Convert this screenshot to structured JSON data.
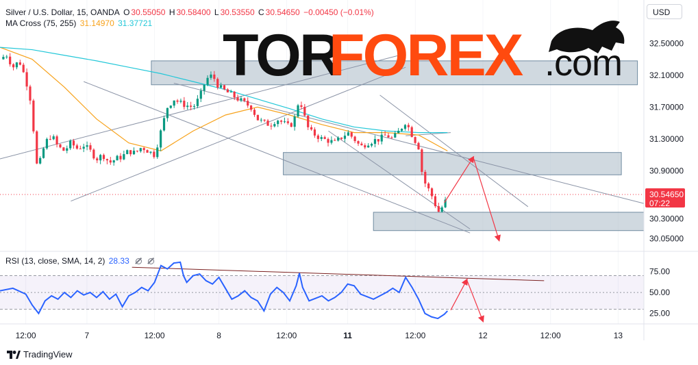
{
  "header": {
    "symbol": "Silver / U.S. Dollar, 15, OANDA",
    "open_label": "O",
    "open": "30.55050",
    "high_label": "H",
    "high": "30.58400",
    "low_label": "L",
    "low": "30.53550",
    "close_label": "C",
    "close": "30.54650",
    "change": "−0.00450 (−0.01%)",
    "ma_title": "MA Cross (75, 255)",
    "ma_fast": "31.14970",
    "ma_slow": "31.37721",
    "rsi_title": "RSI (13, close, SMA, 14, 2)",
    "rsi_value": "28.33"
  },
  "currency_button": "USD",
  "price_tag": {
    "price": "30.54650",
    "countdown": "07:22"
  },
  "brand": {
    "tor": "TOR",
    "forex": "FOREX",
    "com": ".com"
  },
  "footer": {
    "tradingview": "TradingView"
  },
  "colors": {
    "up": "#089981",
    "down": "#f23645",
    "ma_fast": "#f7a21b",
    "ma_slow": "#22c7d8",
    "rsi": "#2962ff",
    "zone": "#a9b9c6",
    "arrow": "#f23645",
    "trendline": "#8a93a6",
    "rsi_trend": "#7a1f1f"
  },
  "chart_data": [
    {
      "type": "candlestick",
      "title": "Silver / U.S. Dollar, 15, OANDA",
      "price_axis_ticks": [
        "32.50000",
        "32.10000",
        "31.70000",
        "31.30000",
        "30.90000",
        "30.30000",
        "30.05000"
      ],
      "ylim": [
        29.95,
        32.7
      ],
      "x_ticks": [
        "12:00",
        "7",
        "12:00",
        "8",
        "12:00",
        "11",
        "12:00",
        "12",
        "12:00",
        "13"
      ],
      "x_tick_bold": [
        false,
        false,
        false,
        false,
        false,
        true,
        false,
        false,
        false,
        false
      ],
      "x_tick_pos": [
        0.04,
        0.135,
        0.24,
        0.34,
        0.445,
        0.54,
        0.645,
        0.75,
        0.855,
        0.96
      ],
      "price_path": [
        [
          0.0,
          32.3
        ],
        [
          0.01,
          32.36
        ],
        [
          0.02,
          32.2
        ],
        [
          0.03,
          32.28
        ],
        [
          0.04,
          32.05
        ],
        [
          0.05,
          31.7
        ],
        [
          0.055,
          31.0
        ],
        [
          0.06,
          30.95
        ],
        [
          0.07,
          31.25
        ],
        [
          0.08,
          31.35
        ],
        [
          0.09,
          31.2
        ],
        [
          0.1,
          31.15
        ],
        [
          0.11,
          31.25
        ],
        [
          0.12,
          31.18
        ],
        [
          0.13,
          31.22
        ],
        [
          0.14,
          31.15
        ],
        [
          0.15,
          31.05
        ],
        [
          0.16,
          31.1
        ],
        [
          0.17,
          31.0
        ],
        [
          0.18,
          31.05
        ],
        [
          0.19,
          31.08
        ],
        [
          0.2,
          31.15
        ],
        [
          0.21,
          31.12
        ],
        [
          0.22,
          31.2
        ],
        [
          0.23,
          31.15
        ],
        [
          0.24,
          31.1
        ],
        [
          0.25,
          31.4
        ],
        [
          0.26,
          31.7
        ],
        [
          0.27,
          31.8
        ],
        [
          0.28,
          31.75
        ],
        [
          0.29,
          31.72
        ],
        [
          0.3,
          31.7
        ],
        [
          0.31,
          31.82
        ],
        [
          0.32,
          32.05
        ],
        [
          0.33,
          32.1
        ],
        [
          0.34,
          31.95
        ],
        [
          0.35,
          31.9
        ],
        [
          0.36,
          31.85
        ],
        [
          0.37,
          31.8
        ],
        [
          0.38,
          31.75
        ],
        [
          0.39,
          31.7
        ],
        [
          0.4,
          31.55
        ],
        [
          0.41,
          31.5
        ],
        [
          0.42,
          31.48
        ],
        [
          0.43,
          31.55
        ],
        [
          0.44,
          31.5
        ],
        [
          0.45,
          31.45
        ],
        [
          0.46,
          31.6
        ],
        [
          0.465,
          31.85
        ],
        [
          0.47,
          31.65
        ],
        [
          0.48,
          31.4
        ],
        [
          0.49,
          31.35
        ],
        [
          0.5,
          31.3
        ],
        [
          0.51,
          31.28
        ],
        [
          0.52,
          31.25
        ],
        [
          0.53,
          31.32
        ],
        [
          0.54,
          31.38
        ],
        [
          0.55,
          31.3
        ],
        [
          0.56,
          31.2
        ],
        [
          0.57,
          31.25
        ],
        [
          0.58,
          31.28
        ],
        [
          0.59,
          31.3
        ],
        [
          0.6,
          31.35
        ],
        [
          0.61,
          31.3
        ],
        [
          0.62,
          31.4
        ],
        [
          0.63,
          31.52
        ],
        [
          0.64,
          31.35
        ],
        [
          0.65,
          31.2
        ],
        [
          0.655,
          30.9
        ],
        [
          0.66,
          30.75
        ],
        [
          0.67,
          30.6
        ],
        [
          0.675,
          30.5
        ],
        [
          0.68,
          30.38
        ],
        [
          0.685,
          30.42
        ],
        [
          0.69,
          30.5
        ],
        [
          0.695,
          30.55
        ]
      ],
      "series": [
        {
          "name": "MA Cross (75, 255)",
          "points": [
            [
              0.0,
              32.45
            ],
            [
              0.05,
              32.3
            ],
            [
              0.1,
              31.95
            ],
            [
              0.15,
              31.55
            ],
            [
              0.2,
              31.25
            ],
            [
              0.25,
              31.15
            ],
            [
              0.3,
              31.4
            ],
            [
              0.35,
              31.6
            ],
            [
              0.4,
              31.7
            ],
            [
              0.45,
              31.6
            ],
            [
              0.5,
              31.48
            ],
            [
              0.55,
              31.38
            ],
            [
              0.6,
              31.38
            ],
            [
              0.65,
              31.35
            ],
            [
              0.695,
              31.15
            ]
          ]
        },
        {
          "name": "MA Cross (75, 255)",
          "points": [
            [
              0.0,
              32.45
            ],
            [
              0.05,
              32.42
            ],
            [
              0.1,
              32.35
            ],
            [
              0.15,
              32.28
            ],
            [
              0.2,
              32.2
            ],
            [
              0.25,
              32.12
            ],
            [
              0.3,
              32.02
            ],
            [
              0.35,
              31.92
            ],
            [
              0.4,
              31.8
            ],
            [
              0.45,
              31.68
            ],
            [
              0.5,
              31.55
            ],
            [
              0.55,
              31.45
            ],
            [
              0.6,
              31.4
            ],
            [
              0.65,
              31.38
            ],
            [
              0.695,
              31.38
            ]
          ]
        }
      ],
      "zones": [
        {
          "x": [
            0.235,
            0.99
          ],
          "y": [
            31.98,
            32.28
          ]
        },
        {
          "x": [
            0.44,
            0.965
          ],
          "y": [
            30.85,
            31.13
          ]
        },
        {
          "x": [
            0.58,
            1.0
          ],
          "y": [
            30.15,
            30.38
          ]
        }
      ],
      "trendlines": [
        [
          [
            0.0,
            31.05
          ],
          [
            0.62,
            32.35
          ]
        ],
        [
          [
            0.11,
            30.52
          ],
          [
            0.63,
            32.2
          ]
        ],
        [
          [
            0.13,
            32.02
          ],
          [
            0.73,
            30.12
          ]
        ],
        [
          [
            0.51,
            31.4
          ],
          [
            0.73,
            30.17
          ]
        ],
        [
          [
            0.27,
            32.0
          ],
          [
            1.0,
            30.49
          ]
        ],
        [
          [
            0.59,
            31.85
          ],
          [
            0.82,
            30.45
          ]
        ],
        [
          [
            0.63,
            31.34
          ],
          [
            0.7,
            31.38
          ]
        ]
      ],
      "arrows": [
        [
          [
            0.69,
            30.5
          ],
          [
            0.735,
            31.07
          ]
        ],
        [
          [
            0.735,
            31.07
          ],
          [
            0.775,
            30.03
          ]
        ]
      ]
    },
    {
      "type": "line",
      "title": "RSI (13, close, SMA, 14, 2)",
      "ylim": [
        15,
        90
      ],
      "y_ticks": [
        "75.00",
        "50.00",
        "25.00"
      ],
      "bands": [
        70,
        50,
        30
      ],
      "rsi_path": [
        [
          0.0,
          52
        ],
        [
          0.02,
          55
        ],
        [
          0.04,
          48
        ],
        [
          0.05,
          35
        ],
        [
          0.06,
          25
        ],
        [
          0.07,
          40
        ],
        [
          0.08,
          46
        ],
        [
          0.09,
          42
        ],
        [
          0.1,
          50
        ],
        [
          0.11,
          44
        ],
        [
          0.12,
          52
        ],
        [
          0.13,
          47
        ],
        [
          0.14,
          50
        ],
        [
          0.15,
          44
        ],
        [
          0.16,
          51
        ],
        [
          0.17,
          42
        ],
        [
          0.18,
          48
        ],
        [
          0.19,
          33
        ],
        [
          0.2,
          46
        ],
        [
          0.21,
          50
        ],
        [
          0.22,
          56
        ],
        [
          0.23,
          52
        ],
        [
          0.24,
          62
        ],
        [
          0.25,
          82
        ],
        [
          0.26,
          78
        ],
        [
          0.27,
          85
        ],
        [
          0.28,
          86
        ],
        [
          0.285,
          70
        ],
        [
          0.29,
          62
        ],
        [
          0.3,
          70
        ],
        [
          0.31,
          72
        ],
        [
          0.32,
          64
        ],
        [
          0.33,
          60
        ],
        [
          0.34,
          68
        ],
        [
          0.35,
          55
        ],
        [
          0.36,
          42
        ],
        [
          0.37,
          46
        ],
        [
          0.38,
          52
        ],
        [
          0.39,
          44
        ],
        [
          0.4,
          40
        ],
        [
          0.41,
          28
        ],
        [
          0.42,
          48
        ],
        [
          0.43,
          56
        ],
        [
          0.44,
          50
        ],
        [
          0.45,
          40
        ],
        [
          0.46,
          58
        ],
        [
          0.465,
          73
        ],
        [
          0.47,
          56
        ],
        [
          0.48,
          40
        ],
        [
          0.49,
          43
        ],
        [
          0.5,
          46
        ],
        [
          0.51,
          40
        ],
        [
          0.52,
          44
        ],
        [
          0.53,
          50
        ],
        [
          0.54,
          60
        ],
        [
          0.55,
          58
        ],
        [
          0.56,
          48
        ],
        [
          0.57,
          45
        ],
        [
          0.58,
          42
        ],
        [
          0.59,
          46
        ],
        [
          0.6,
          50
        ],
        [
          0.61,
          55
        ],
        [
          0.62,
          50
        ],
        [
          0.63,
          68
        ],
        [
          0.64,
          56
        ],
        [
          0.65,
          42
        ],
        [
          0.66,
          25
        ],
        [
          0.67,
          21
        ],
        [
          0.68,
          19
        ],
        [
          0.69,
          24
        ],
        [
          0.695,
          28
        ]
      ],
      "trendline": [
        [
          0.205,
          80
        ],
        [
          0.845,
          64
        ]
      ],
      "arrows": [
        [
          [
            0.7,
            29
          ],
          [
            0.725,
            65
          ]
        ],
        [
          [
            0.725,
            65
          ],
          [
            0.75,
            16
          ]
        ]
      ]
    }
  ]
}
